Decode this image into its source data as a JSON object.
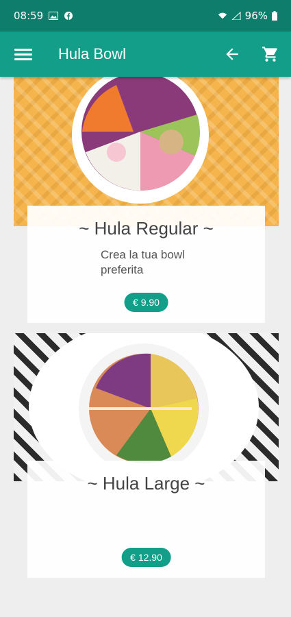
{
  "status": {
    "time": "08:59",
    "battery": "96%"
  },
  "appbar": {
    "title": "Hula Bowl"
  },
  "products": [
    {
      "name": "~ Hula Regular ~",
      "description": "Crea la tua bowl preferita",
      "price": "€ 9.90"
    },
    {
      "name": "~ Hula Large ~",
      "description": "",
      "price": "€ 12.90"
    }
  ],
  "colors": {
    "primary": "#129e88",
    "statusbar": "#0e7d6b"
  },
  "icons": [
    "menu-icon",
    "arrow-back-icon",
    "shopping-cart-icon",
    "gallery-icon",
    "facebook-icon",
    "wifi-icon",
    "signal-icon",
    "battery-icon"
  ]
}
